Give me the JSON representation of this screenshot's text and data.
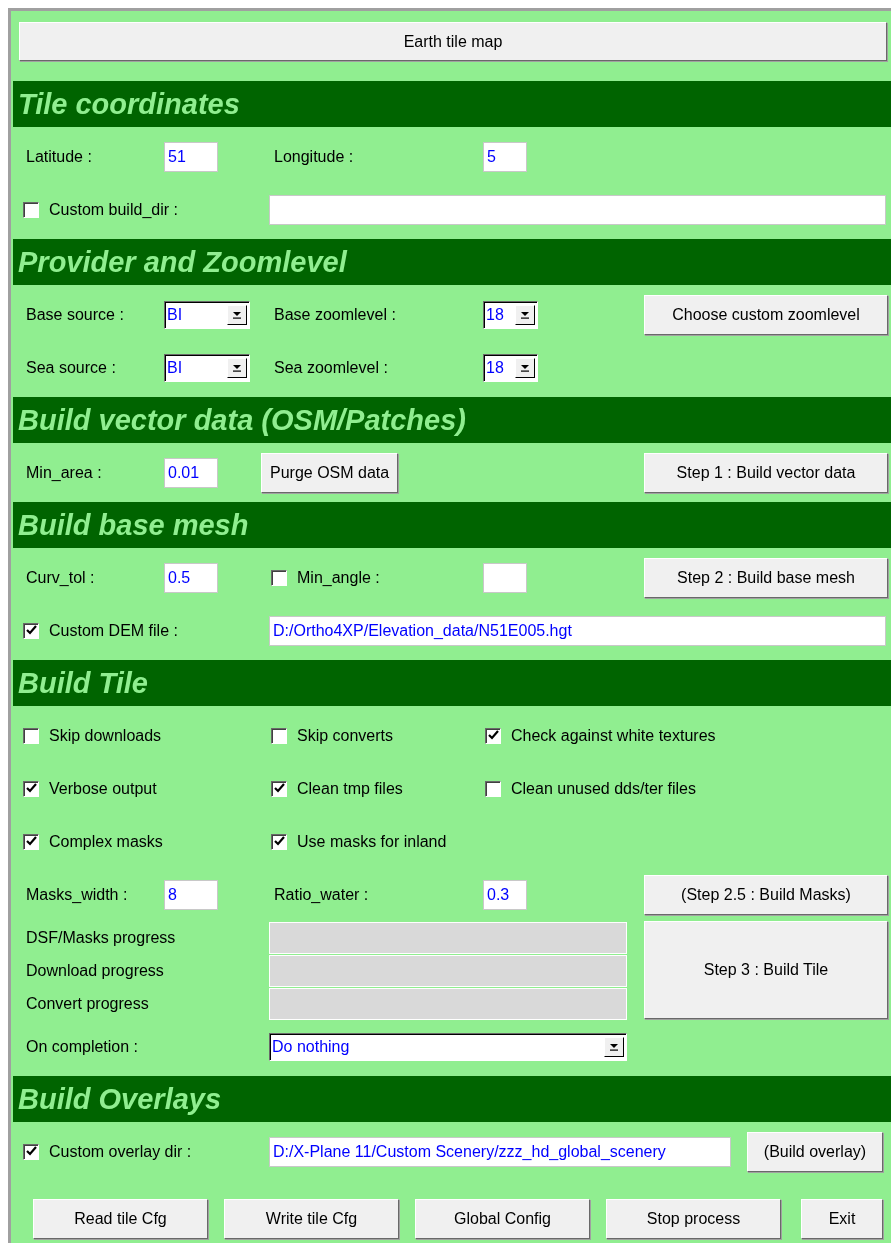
{
  "top_button": "Earth tile map",
  "sections": [
    {
      "title": "Tile coordinates",
      "rows": [
        [
          {
            "kind": "label",
            "text": "Latitude :"
          },
          {
            "kind": "field",
            "value": "51"
          },
          {
            "kind": "label",
            "text": "Longitude :"
          },
          {
            "kind": "field",
            "value": "5"
          }
        ],
        [
          {
            "kind": "checkbox",
            "label": "Custom build_dir :",
            "checked": false
          },
          "",
          {
            "kind": "path"
          }
        ]
      ]
    },
    {
      "title": "Provider and Zoomlevel",
      "rows": [
        [
          {
            "kind": "label",
            "text": "Base source :"
          },
          {
            "kind": "dropdown",
            "value": "BI"
          },
          {
            "kind": "label",
            "text": "Base zoomlevel :"
          },
          {
            "kind": "dropdown",
            "value": "18"
          },
          {
            "kind": "action",
            "text": "Choose custom zoomlevel"
          }
        ],
        [
          {
            "kind": "label",
            "text": "Sea source :"
          },
          {
            "kind": "dropdown",
            "value": "BI"
          },
          {
            "kind": "label",
            "text": "Sea zoomlevel :"
          },
          {
            "kind": "dropdown",
            "value": "18"
          }
        ]
      ]
    },
    {
      "title": "Build vector data (OSM/Patches)",
      "rows": [
        [
          {
            "kind": "label",
            "text": "Min_area :"
          },
          {
            "kind": "field",
            "value": "0.01"
          },
          {
            "kind": "button",
            "text": "Purge OSM data"
          },
          "",
          {
            "kind": "action",
            "text": "Step 1 : Build vector data"
          }
        ]
      ]
    },
    {
      "title": "Build base mesh",
      "rows": [
        [
          {
            "kind": "label",
            "text": "Curv_tol :"
          },
          {
            "kind": "field",
            "value": "0.5"
          },
          {
            "kind": "checkbox",
            "label": "Min_angle :",
            "checked": false
          },
          {
            "kind": "field"
          },
          {
            "kind": "action",
            "text": "Step 2 : Build base mesh"
          }
        ],
        [
          {
            "kind": "checkbox",
            "label": "Custom DEM file :",
            "checked": true
          },
          "",
          {
            "kind": "path",
            "value": "D:/Ortho4XP/Elevation_data/N51E005.hgt"
          }
        ]
      ]
    },
    {
      "title": "Build Tile",
      "rows": [
        [
          {
            "kind": "checkbox",
            "label": "Skip downloads",
            "checked": false
          },
          "",
          {
            "kind": "checkbox",
            "label": "Skip converts",
            "checked": false
          },
          {
            "kind": "checkbox",
            "label": "Check against white textures",
            "checked": true
          }
        ],
        [
          {
            "kind": "checkbox",
            "label": "Verbose output",
            "checked": true
          },
          "",
          {
            "kind": "checkbox",
            "label": "Clean tmp files",
            "checked": true
          },
          {
            "kind": "checkbox",
            "label": "Clean unused dds/ter files",
            "checked": false
          }
        ],
        [
          {
            "kind": "checkbox",
            "label": "Complex masks",
            "checked": true
          },
          "",
          {
            "kind": "checkbox",
            "label": "Use masks for inland",
            "checked": true
          }
        ],
        [
          {
            "kind": "label",
            "text": "Masks_width :"
          },
          {
            "kind": "field",
            "value": "8"
          },
          {
            "kind": "label",
            "text": "Ratio_water :"
          },
          {
            "kind": "field",
            "value": "0.3"
          },
          {
            "kind": "action",
            "text": "(Step 2.5 : Build Masks)"
          }
        ],
        [
          {
            "kind": "caption",
            "text": "DSF/Masks progress"
          },
          "",
          {
            "kind": "progress",
            "level": 0
          },
          "",
          {
            "kind": "tall-action",
            "text": "Step 3 : Build Tile"
          }
        ],
        [
          {
            "kind": "caption",
            "text": "Download progress"
          },
          "",
          {
            "kind": "progress",
            "level": 0
          }
        ],
        [
          {
            "kind": "caption",
            "text": "Convert progress"
          },
          "",
          {
            "kind": "progress",
            "level": 0
          }
        ],
        [
          {
            "kind": "caption",
            "text": "On completion :"
          },
          "",
          {
            "kind": "long-dropdown",
            "value": "Do nothing"
          }
        ]
      ]
    },
    {
      "title": "Build Overlays",
      "rows": [
        [
          {
            "kind": "checkbox",
            "label": "Custom overlay dir :",
            "checked": true
          },
          "",
          {
            "kind": "path",
            "value": "D:/X-Plane 11/Custom Scenery/zzz_hd_global_scenery"
          },
          {
            "kind": "button",
            "text": "(Build overlay)"
          }
        ]
      ]
    }
  ],
  "footer_buttons": [
    "Read tile Cfg",
    "Write tile Cfg",
    "Global Config",
    "Stop process",
    "Exit"
  ]
}
